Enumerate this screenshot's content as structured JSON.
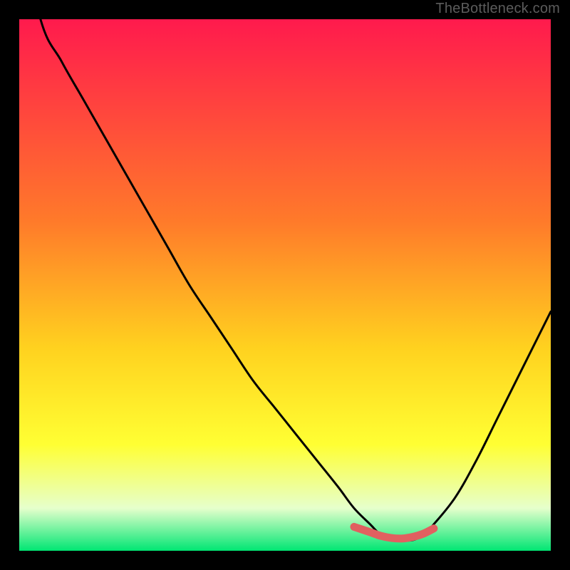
{
  "watermark": "TheBottleneck.com",
  "colors": {
    "bg_black": "#000000",
    "grad_top": "#ff1a4d",
    "grad_mid1": "#ff7a2a",
    "grad_mid2": "#ffd21f",
    "grad_mid3": "#ffff33",
    "grad_bottom_hl": "#e6ffcc",
    "grad_bottom": "#00e673",
    "curve_stroke": "#000000",
    "highlight_stroke": "#e16060"
  },
  "chart_data": {
    "type": "line",
    "title": "",
    "xlabel": "",
    "ylabel": "",
    "xlim": [
      0,
      100
    ],
    "ylim": [
      0,
      100
    ],
    "series": [
      {
        "name": "bottleneck-curve",
        "x": [
          0,
          4,
          8,
          12,
          16,
          20,
          24,
          28,
          32,
          36,
          40,
          44,
          48,
          52,
          56,
          60,
          63,
          66,
          68,
          70,
          72,
          74,
          76,
          78,
          82,
          86,
          90,
          94,
          98,
          100
        ],
        "values": [
          120,
          100,
          92,
          85,
          78,
          71,
          64,
          57,
          50,
          44,
          38,
          32,
          27,
          22,
          17,
          12,
          8,
          5,
          3,
          2,
          2,
          2,
          3,
          5,
          10,
          17,
          25,
          33,
          41,
          45
        ]
      }
    ],
    "highlight_segment": {
      "x": [
        63,
        66,
        68,
        70,
        72,
        74,
        76,
        78
      ],
      "values": [
        4.5,
        3.5,
        2.8,
        2.4,
        2.3,
        2.6,
        3.2,
        4.2
      ]
    }
  }
}
